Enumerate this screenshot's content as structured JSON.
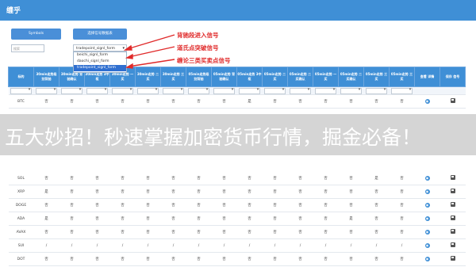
{
  "app": {
    "title": "缠乎"
  },
  "toolbar": {
    "symbols_button": "Symbols",
    "signal_button": "选择信号数据表",
    "search_placeholder": "搜索"
  },
  "signal_select": {
    "selected": "tradepoint_signl_form",
    "options": [
      "beichi_signl_form",
      "daochi_signl_form",
      "tradepoint_signl_form"
    ]
  },
  "annotations": [
    "背驰段进入信号",
    "道氏点突破信号",
    "缠论三类买卖点信号"
  ],
  "annotation_color": "#e02a2a",
  "table": {
    "headers": [
      "标的",
      "30min走势级 别背驰",
      "30min走势 背驰确认",
      "30min走势 3中枢",
      "30min走势 一买",
      "30min走势 二买",
      "30min走势 三买",
      "05min走势级 别背驰",
      "05min走势 背驰确认",
      "05min走势 3中枢",
      "05min走势 二买",
      "05min走势 二买确认",
      "05min走势 一买",
      "05min走势 二买确认",
      "05min走势 三买",
      "05min走势 三买",
      "查看 详情",
      "保存 信号"
    ],
    "rows": [
      {
        "symbol": "BTC",
        "cells": [
          "否",
          "否",
          "否",
          "否",
          "否",
          "否",
          "否",
          "否",
          "是",
          "否",
          "否",
          "否",
          "否",
          "否",
          "否"
        ]
      },
      {
        "symbol": "SOL",
        "cells": [
          "否",
          "否",
          "否",
          "否",
          "否",
          "否",
          "否",
          "否",
          "否",
          "否",
          "否",
          "否",
          "否",
          "是",
          "否"
        ]
      },
      {
        "symbol": "XRP",
        "cells": [
          "是",
          "否",
          "否",
          "否",
          "否",
          "否",
          "否",
          "否",
          "否",
          "否",
          "否",
          "否",
          "否",
          "否",
          "否"
        ]
      },
      {
        "symbol": "DOGE",
        "cells": [
          "否",
          "否",
          "否",
          "否",
          "否",
          "否",
          "否",
          "否",
          "否",
          "否",
          "否",
          "否",
          "否",
          "否",
          "否"
        ]
      },
      {
        "symbol": "ADA",
        "cells": [
          "是",
          "否",
          "否",
          "否",
          "否",
          "否",
          "否",
          "否",
          "否",
          "否",
          "否",
          "否",
          "是",
          "否",
          "否"
        ]
      },
      {
        "symbol": "AVAX",
        "cells": [
          "否",
          "否",
          "否",
          "否",
          "否",
          "否",
          "否",
          "否",
          "否",
          "否",
          "否",
          "否",
          "否",
          "否",
          "否"
        ]
      },
      {
        "symbol": "SUI",
        "cells": [
          "/",
          "/",
          "/",
          "/",
          "/",
          "/",
          "/",
          "/",
          "/",
          "/",
          "/",
          "/",
          "/",
          "/",
          "/"
        ]
      },
      {
        "symbol": "DOT",
        "cells": [
          "否",
          "否",
          "否",
          "否",
          "否",
          "否",
          "否",
          "否",
          "否",
          "否",
          "否",
          "否",
          "否",
          "否",
          "否"
        ]
      }
    ],
    "view_icon": "eye-icon",
    "save_icon": "save-icon"
  },
  "banner": {
    "text": "五大妙招！秒速掌握加密货币行情，掘金必备！"
  },
  "colors": {
    "header_blue": "#3f8fd6",
    "banner_bg": "#d2d2d2"
  }
}
